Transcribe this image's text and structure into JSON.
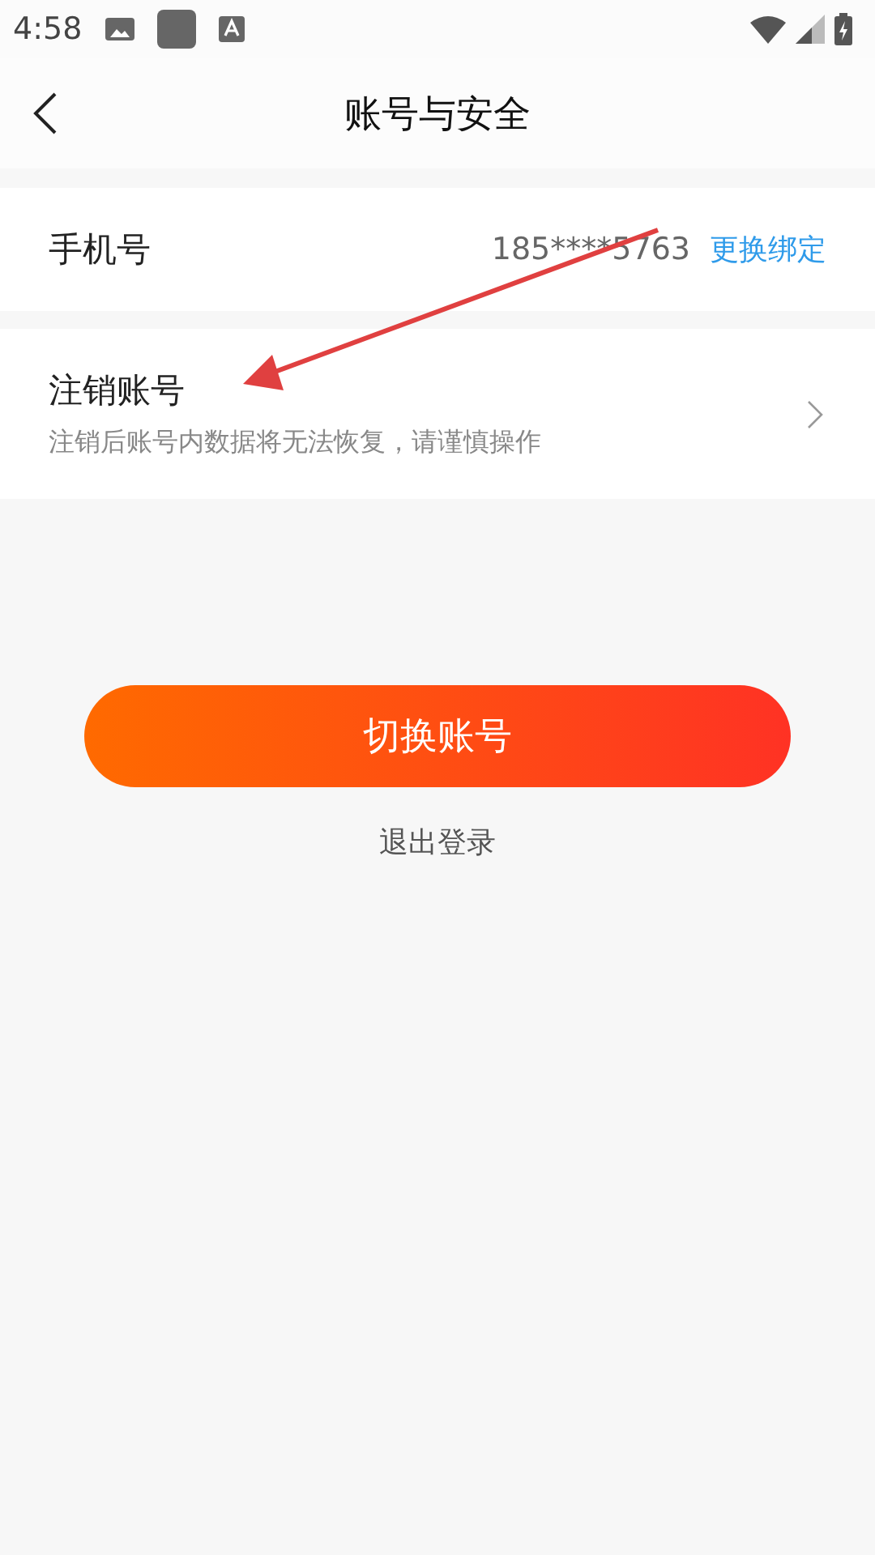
{
  "status_bar": {
    "time": "4:58"
  },
  "header": {
    "title": "账号与安全"
  },
  "phone_row": {
    "label": "手机号",
    "value": "185****5763",
    "action": "更换绑定"
  },
  "cancel_row": {
    "title": "注销账号",
    "subtitle": "注销后账号内数据将无法恢复，请谨慎操作"
  },
  "switch_button": {
    "label": "切换账号"
  },
  "logout_link": {
    "label": "退出登录"
  }
}
